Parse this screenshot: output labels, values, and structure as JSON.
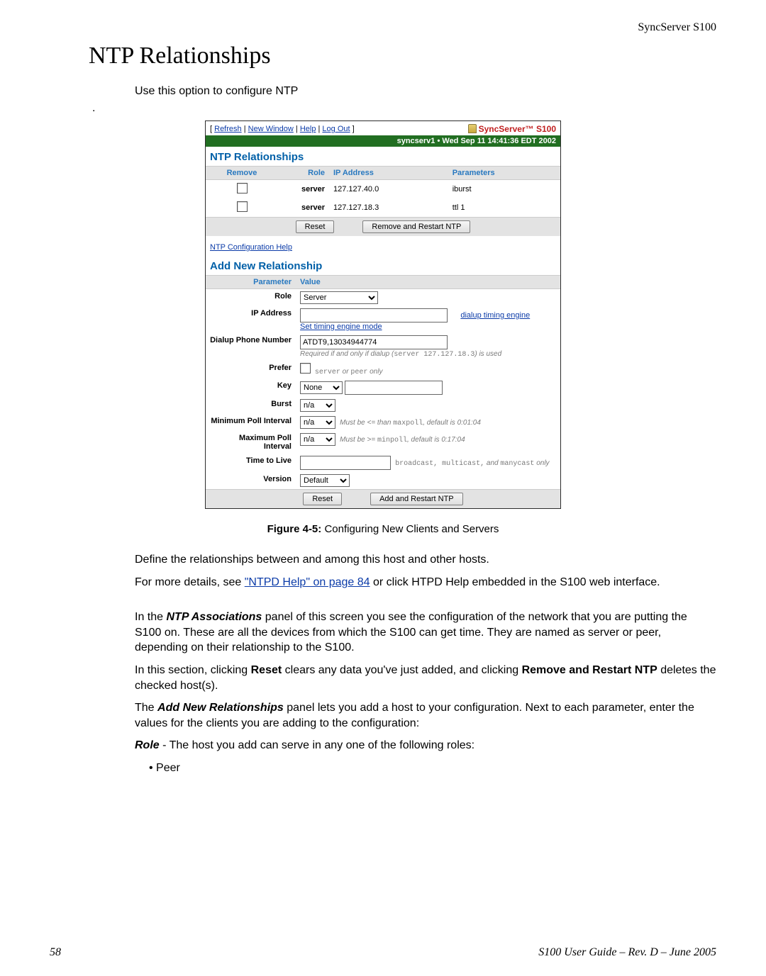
{
  "header": {
    "product": "SyncServer S100"
  },
  "title": "NTP Relationships",
  "intro": "Use this option to configure NTP",
  "dot": ".",
  "screenshot": {
    "topbar_links": [
      "Refresh",
      "New Window",
      "Help",
      "Log Out"
    ],
    "brand": "SyncServer™ S100",
    "status_bar": "syncserv1 • Wed Sep 11 14:41:36 EDT 2002",
    "section1_title": "NTP Relationships",
    "table_headers": {
      "remove": "Remove",
      "role": "Role",
      "ip": "IP Address",
      "params": "Parameters"
    },
    "rows": [
      {
        "role": "server",
        "ip": "127.127.40.0",
        "params": "iburst"
      },
      {
        "role": "server",
        "ip": "127.127.18.3",
        "params": "ttl 1"
      }
    ],
    "btn_reset": "Reset",
    "btn_remove": "Remove and Restart NTP",
    "config_help": "NTP Configuration Help",
    "section2_title": "Add New Relationship",
    "param_header": "Parameter",
    "value_header": "Value",
    "fields": {
      "role_label": "Role",
      "role_value": "Server",
      "ip_label": "IP Address",
      "ip_link": "dialup timing engine",
      "ip_sub": "Set timing engine mode",
      "dialup_label": "Dialup Phone Number",
      "dialup_value": "ATDT9,13034944774",
      "dialup_hint_prefix": "Required if and only if dialup (",
      "dialup_hint_mono": "server 127.127.18.3",
      "dialup_hint_suffix": ") is used",
      "prefer_label": "Prefer",
      "prefer_hint_mono1": "server",
      "prefer_hint_mid": " or ",
      "prefer_hint_mono2": "peer",
      "prefer_hint_suffix": " only",
      "key_label": "Key",
      "key_value": "None",
      "burst_label": "Burst",
      "burst_value": "n/a",
      "minpoll_label": "Minimum Poll Interval",
      "minpoll_value": "n/a",
      "minpoll_hint_prefix": "Must be <= than ",
      "minpoll_hint_mono": "maxpoll",
      "minpoll_hint_suffix": ", default is 0:01:04",
      "maxpoll_label": "Maximum Poll Interval",
      "maxpoll_value": "n/a",
      "maxpoll_hint_prefix": "Must be >= ",
      "maxpoll_hint_mono": "minpoll",
      "maxpoll_hint_suffix": ", default is 0:17:04",
      "ttl_label": "Time to Live",
      "ttl_hint_mono": "broadcast, multicast,",
      "ttl_hint_mid": " and ",
      "ttl_hint_mono2": "manycast",
      "ttl_hint_suffix": " only",
      "version_label": "Version",
      "version_value": "Default"
    },
    "btn_reset2": "Reset",
    "btn_add": "Add and Restart NTP"
  },
  "caption_label": "Figure 4-5:",
  "caption_text": "  Configuring New Clients and Servers",
  "paras": {
    "p1": "Define the relationships between and among this host and other hosts.",
    "p2a": "For more details, see ",
    "p2link": "\"NTPD Help\" on page 84",
    "p2b": " or click HTPD Help embedded in the S100 web interface.",
    "p3a": "In the ",
    "p3b": "NTP Associations",
    "p3c": " panel of this screen you see the configuration of the network that you are putting the S100 on. These are all the devices from which the S100 can get time. They are named as server or peer, depending on their relationship to the S100.",
    "p4a": "In this section, clicking ",
    "p4b": "Reset",
    "p4c": " clears any data you've just added, and clicking ",
    "p4d": "Remove and Restart NTP",
    "p4e": " deletes the checked host(s).",
    "p5a": "The ",
    "p5b": "Add New Relationships",
    "p5c": " panel lets you add a host to your configuration. Next to each parameter, enter the values for the clients you are adding to the configuration:",
    "p6a": "Role",
    "p6b": " - The host you add can serve in any one of the following roles:",
    "bullet1": "Peer"
  },
  "footer": {
    "page": "58",
    "right": "S100 User Guide – Rev. D – June 2005"
  }
}
